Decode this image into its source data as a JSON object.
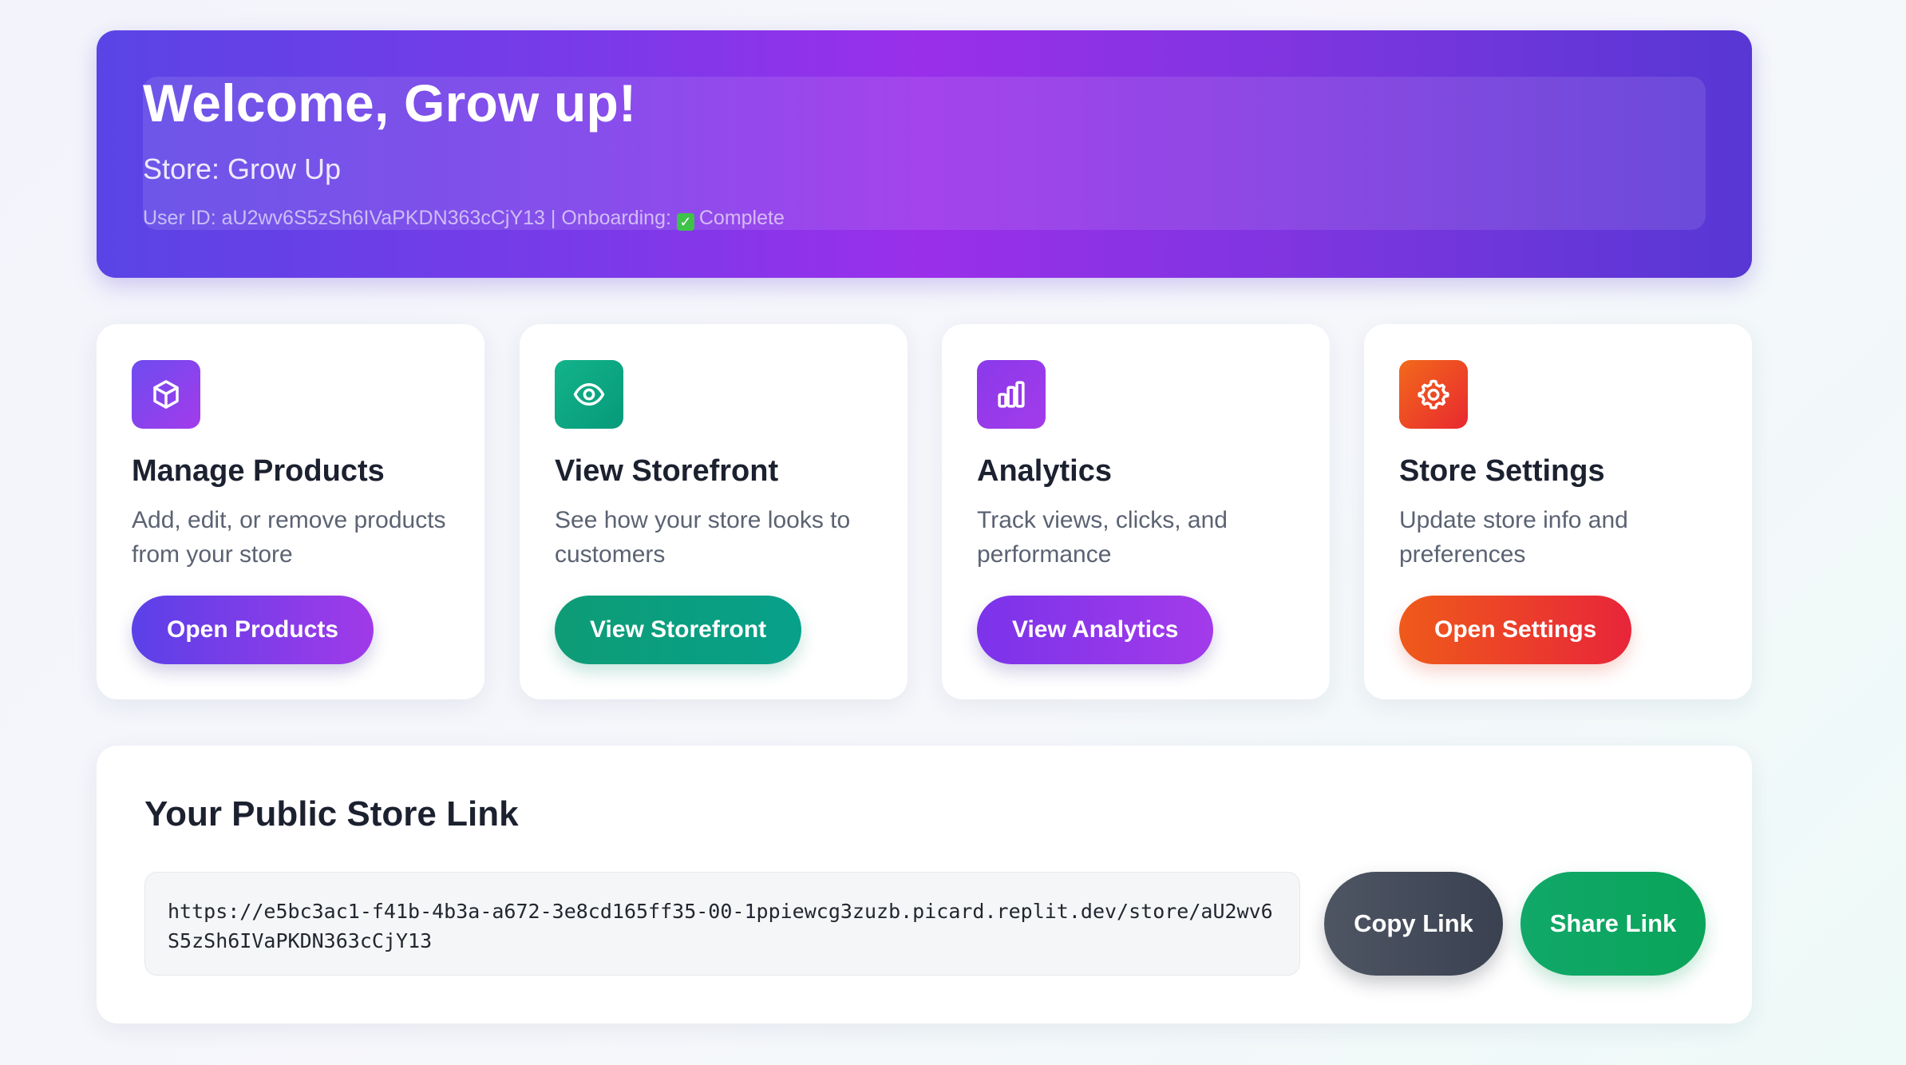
{
  "header": {
    "welcome": "Welcome, Grow up!",
    "store_line": "Store: Grow Up",
    "user_id_line": "User ID: aU2wv6S5zSh6IVaPKDN363cCjY13 | Onboarding:",
    "onboarding_status": "Complete",
    "gradient_colors": [
      "#5a44e6",
      "#9a2fea",
      "#5737d4"
    ]
  },
  "cards": [
    {
      "icon": "box-icon",
      "title": "Manage Products",
      "description": "Add, edit, or remove products from your store",
      "button": "Open Products",
      "accent": "#6d4cf0"
    },
    {
      "icon": "eye-icon",
      "title": "View Storefront",
      "description": "See how your store looks to customers",
      "button": "View Storefront",
      "accent": "#0e9c76"
    },
    {
      "icon": "bar-chart-icon",
      "title": "Analytics",
      "description": "Track views, clicks, and performance",
      "button": "View Analytics",
      "accent": "#8a3aea"
    },
    {
      "icon": "gear-icon",
      "title": "Store Settings",
      "description": "Update store info and preferences",
      "button": "Open Settings",
      "accent": "#ef5a1a"
    }
  ],
  "public_link": {
    "title": "Your Public Store Link",
    "url": "https://e5bc3ac1-f41b-4b3a-a672-3e8cd165ff35-00-1ppiewcg3zuzb.picard.replit.dev/store/aU2wv6S5zSh6IVaPKDN363cCjY13",
    "copy_label": "Copy Link",
    "share_label": "Share Link"
  }
}
